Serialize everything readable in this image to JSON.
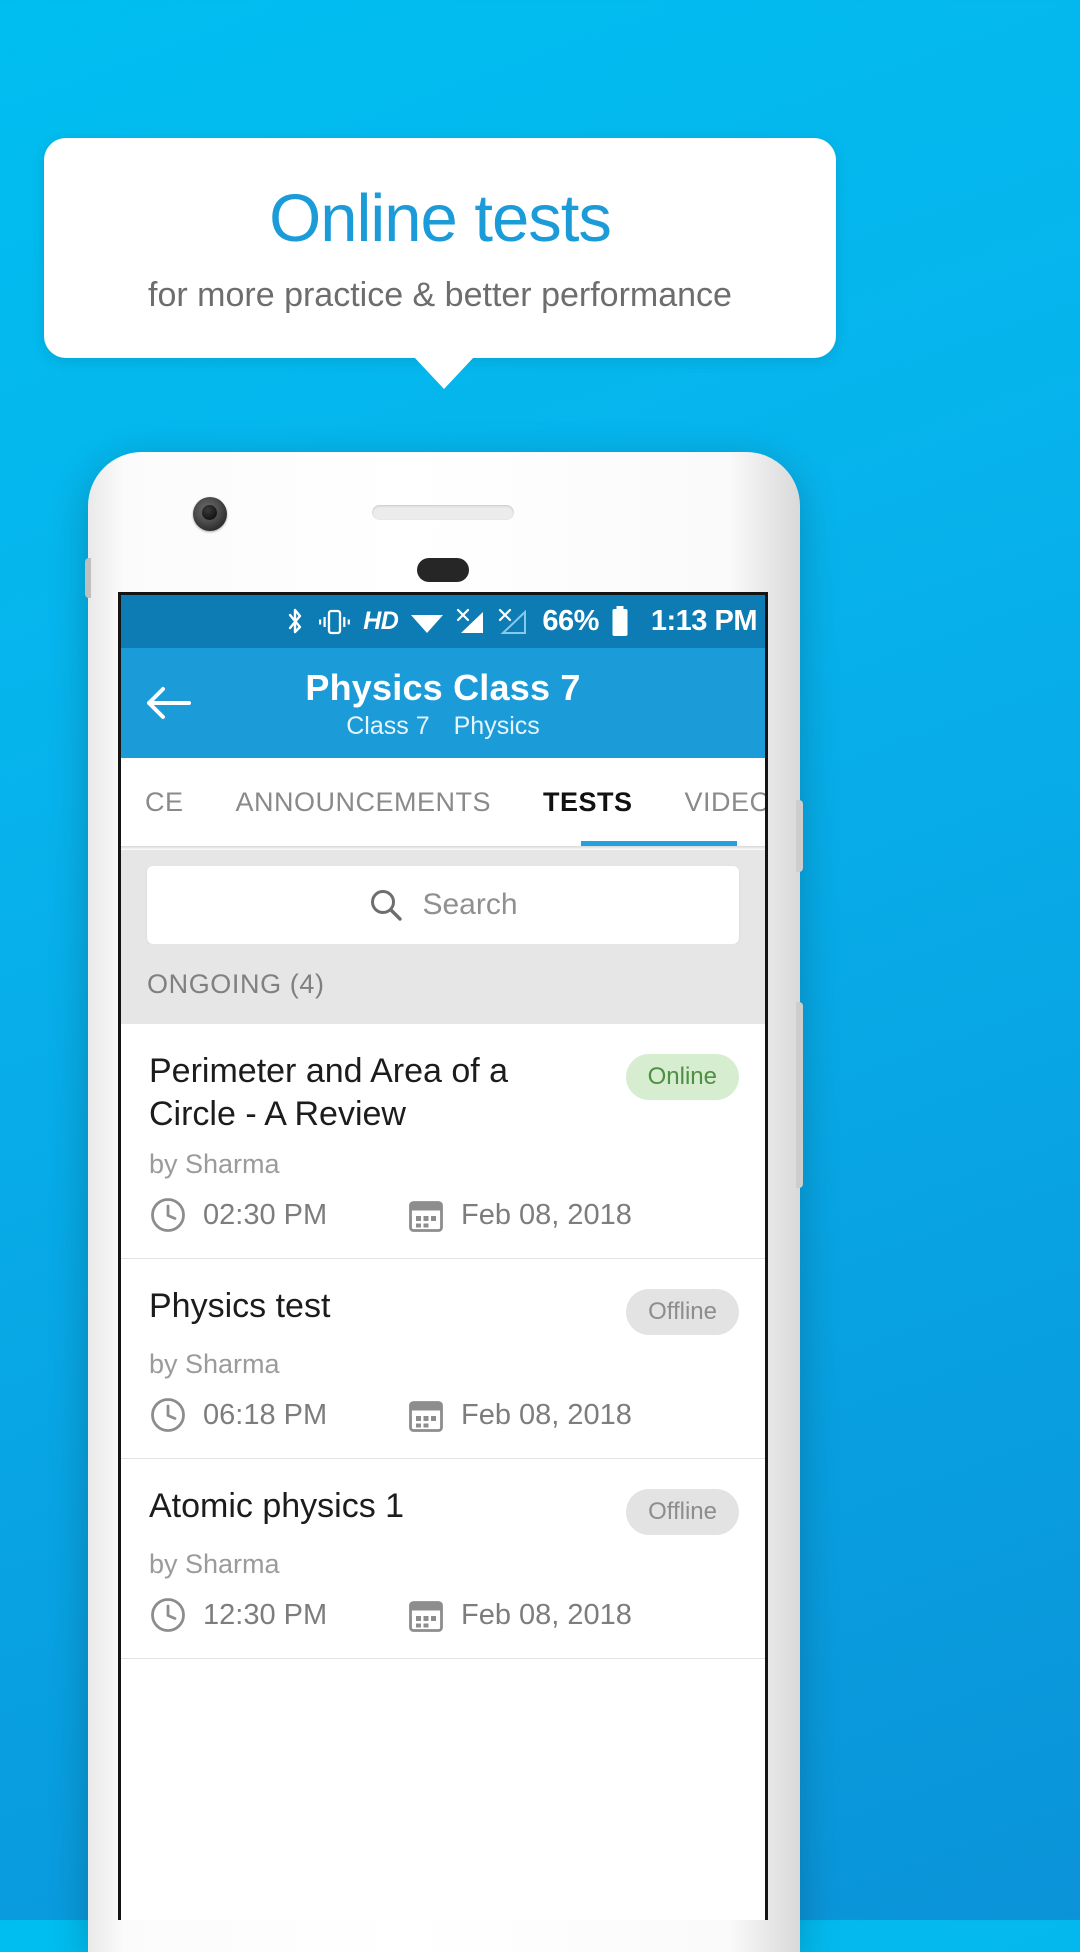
{
  "promo": {
    "title": "Online tests",
    "subtitle": "for more practice & better performance",
    "title_color": "#1b9bd8",
    "subtitle_color": "#6d6d6d",
    "background_color": "#ffffff"
  },
  "background": {
    "accent_color": "#07b3ec"
  },
  "status_bar": {
    "icons": [
      "bluetooth-icon",
      "vibrate-icon",
      "hd-icon",
      "wifi-icon",
      "signal-off-icon",
      "signal-off-2-icon",
      "battery-icon"
    ],
    "hd_label": "HD",
    "battery_percent": "66%",
    "time": "1:13 PM",
    "background_color": "#0d7cb5"
  },
  "app_bar": {
    "back_icon": "back-arrow-icon",
    "title": "Physics Class 7",
    "subtitle_class": "Class 7",
    "subtitle_subject": "Physics",
    "background_color": "#1b9bd8"
  },
  "tabs": {
    "items": [
      {
        "label": "CE",
        "active": false
      },
      {
        "label": "ANNOUNCEMENTS",
        "active": false
      },
      {
        "label": "TESTS",
        "active": true
      },
      {
        "label": "VIDEOS",
        "active": false
      }
    ],
    "indicator_color": "#25a2dd"
  },
  "search": {
    "placeholder": "Search",
    "value": "",
    "icon": "search-icon"
  },
  "section": {
    "label": "ONGOING (4)"
  },
  "tests": [
    {
      "title": "Perimeter and Area of a Circle - A Review",
      "status": "Online",
      "status_kind": "online",
      "author": "by Sharma",
      "time": "02:30 PM",
      "date": "Feb 08, 2018"
    },
    {
      "title": "Physics test",
      "status": "Offline",
      "status_kind": "offline",
      "author": "by Sharma",
      "time": "06:18 PM",
      "date": "Feb 08, 2018"
    },
    {
      "title": "Atomic physics 1",
      "status": "Offline",
      "status_kind": "offline",
      "author": "by Sharma",
      "time": "12:30 PM",
      "date": "Feb 08, 2018"
    }
  ],
  "colors": {
    "online_badge_bg": "#d6edd0",
    "online_badge_text": "#4f8f45",
    "offline_badge_bg": "#e3e3e3",
    "offline_badge_text": "#8d8d8d"
  }
}
